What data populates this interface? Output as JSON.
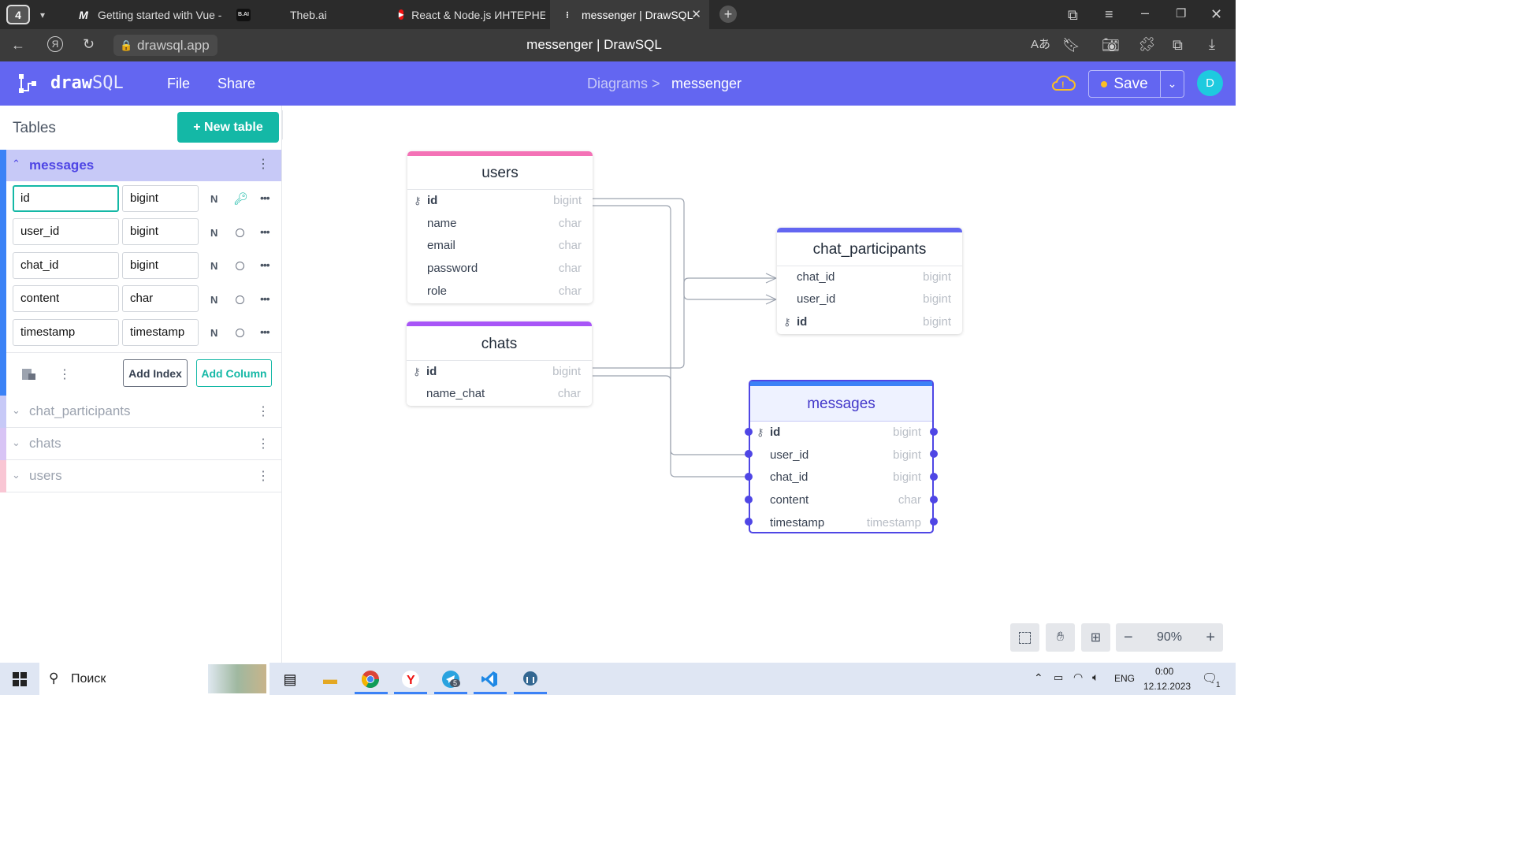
{
  "browser": {
    "tab_count": "4",
    "tabs": [
      {
        "label": "Getting started with Vue -",
        "favicon": "M"
      },
      {
        "label": "Theb.ai",
        "favicon": "B.AI"
      },
      {
        "label": "React & Node.js ИНТЕРНЕ",
        "favicon": "youtube-icon"
      },
      {
        "label": "messenger | DrawSQL",
        "favicon": "drawsql-icon"
      }
    ],
    "url": "drawsql.app",
    "page_title": "messenger | DrawSQL"
  },
  "app": {
    "logo_bold": "draw",
    "logo_light": "SQL",
    "menu": [
      "File",
      "Share"
    ],
    "breadcrumb_parent": "Diagrams >",
    "breadcrumb_current": "messenger",
    "save_label": "Save",
    "avatar_letter": "D",
    "accent": "#6366f1",
    "teal": "#14b8a6"
  },
  "sidebar": {
    "title": "Tables",
    "new_table_label": "+ New table",
    "expanded_table": "messages",
    "columns": [
      {
        "name": "id",
        "type": "bigint",
        "nullable": "N",
        "primary": true
      },
      {
        "name": "user_id",
        "type": "bigint",
        "nullable": "N",
        "primary": false
      },
      {
        "name": "chat_id",
        "type": "bigint",
        "nullable": "N",
        "primary": false
      },
      {
        "name": "content",
        "type": "char",
        "nullable": "N",
        "primary": false
      },
      {
        "name": "timestamp",
        "type": "timestamp",
        "nullable": "N",
        "primary": false
      }
    ],
    "add_index_label": "Add Index",
    "add_column_label": "Add Column",
    "collapsed_tables": [
      {
        "name": "chat_participants",
        "color": "#c7c9f7"
      },
      {
        "name": "chats",
        "color": "#d8c4f5"
      },
      {
        "name": "users",
        "color": "#f9c6d4"
      }
    ]
  },
  "diagram": {
    "users": {
      "title": "users",
      "color": "#f472b6",
      "rows": [
        [
          "id",
          "bigint"
        ],
        [
          "name",
          "char"
        ],
        [
          "email",
          "char"
        ],
        [
          "password",
          "char"
        ],
        [
          "role",
          "char"
        ]
      ]
    },
    "chats": {
      "title": "chats",
      "color": "#a855f7",
      "rows": [
        [
          "id",
          "bigint"
        ],
        [
          "name_chat",
          "char"
        ]
      ]
    },
    "chat_participants": {
      "title": "chat_participants",
      "color": "#6366f1",
      "rows": [
        [
          "chat_id",
          "bigint"
        ],
        [
          "user_id",
          "bigint"
        ],
        [
          "id",
          "bigint"
        ]
      ]
    },
    "messages": {
      "title": "messages",
      "color": "#3b82f6",
      "rows": [
        [
          "id",
          "bigint"
        ],
        [
          "user_id",
          "bigint"
        ],
        [
          "chat_id",
          "bigint"
        ],
        [
          "content",
          "char"
        ],
        [
          "timestamp",
          "timestamp"
        ]
      ]
    }
  },
  "zoom": {
    "level": "90%"
  },
  "taskbar": {
    "search_placeholder": "Поиск",
    "lang": "ENG",
    "time": "0:00",
    "date": "12.12.2023",
    "telegram_badge": "5",
    "notif_count": "1"
  }
}
